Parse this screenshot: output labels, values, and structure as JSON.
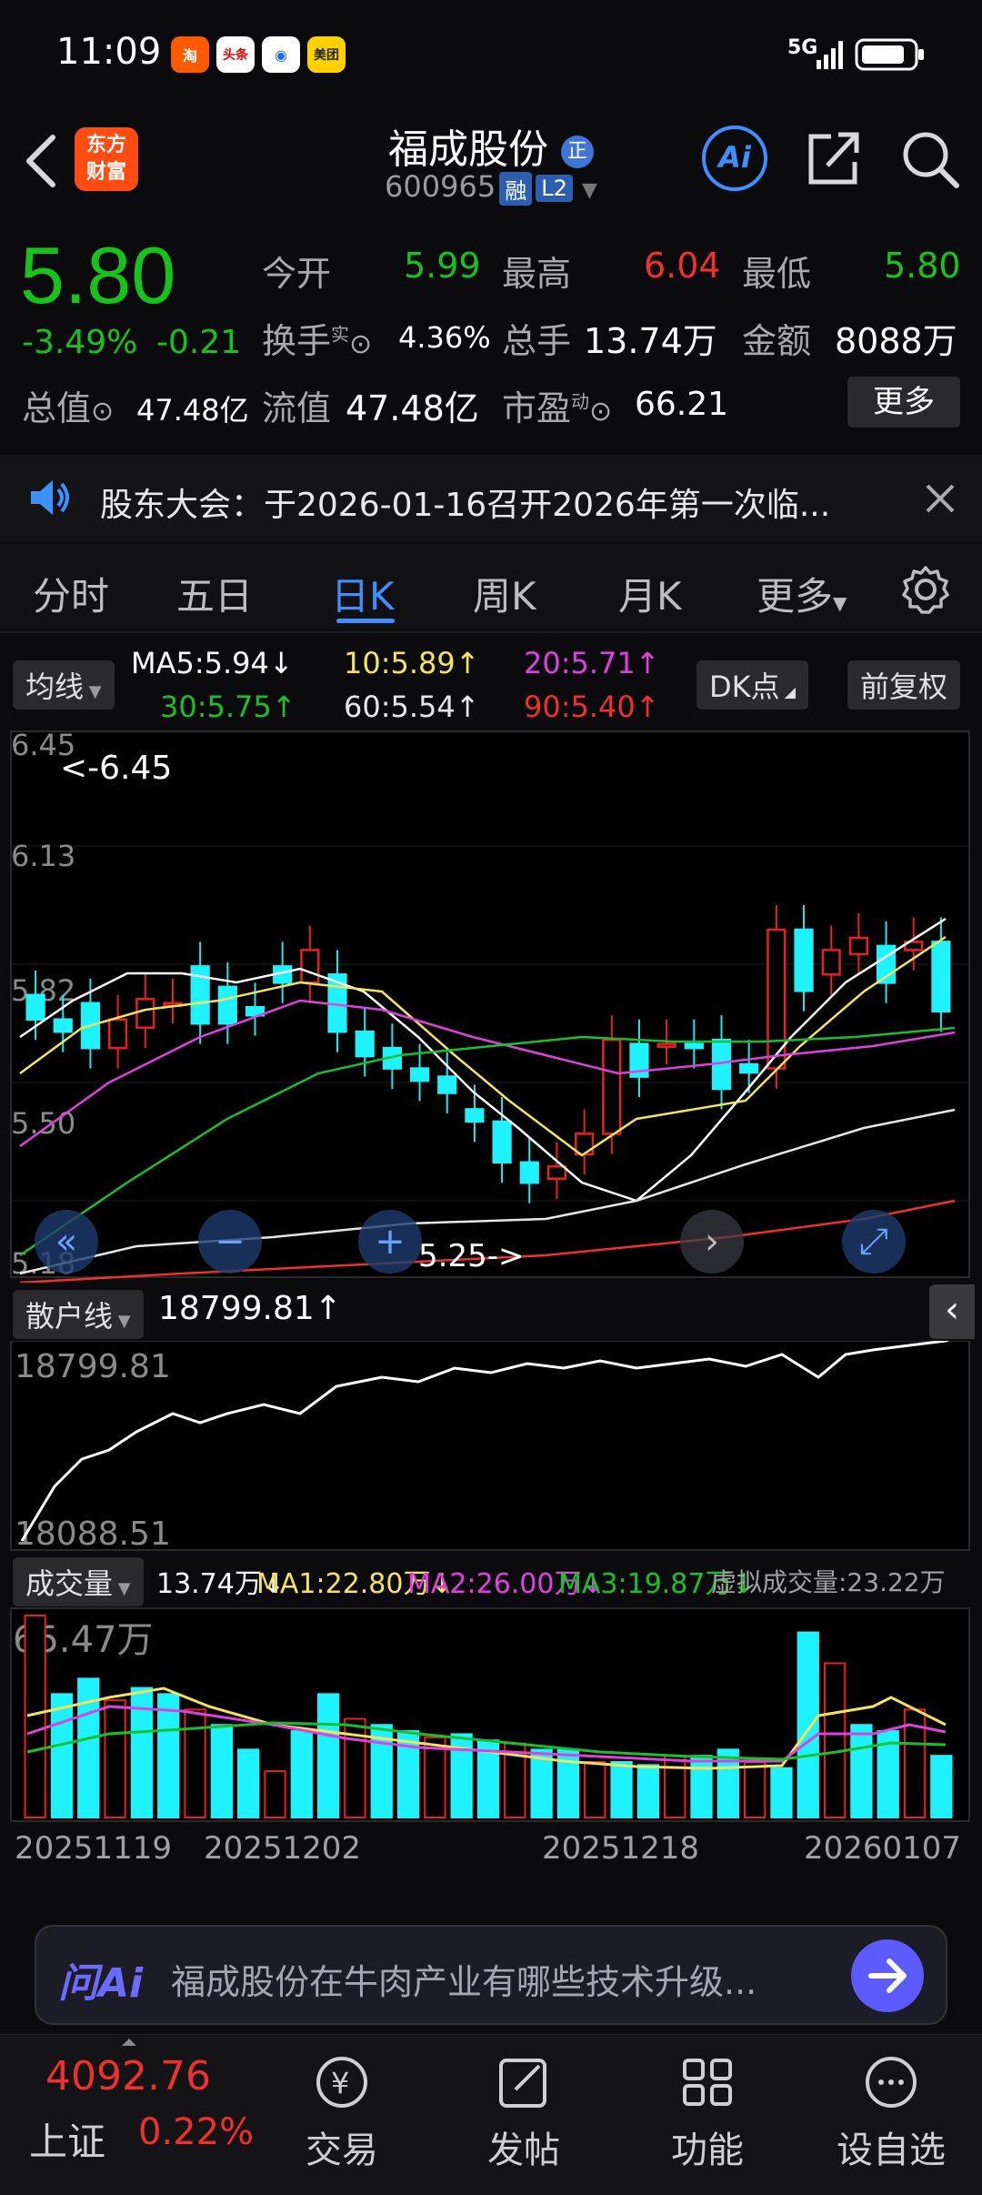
{
  "status_bar": {
    "time": "11:09",
    "apps": [
      "淘",
      "头条",
      "◉",
      "美团"
    ],
    "network": "5G"
  },
  "header": {
    "back_icon": "chevron-left-icon",
    "logo_line1": "东方",
    "logo_line2": "财富",
    "stock_name": "福成股份",
    "badge": "正",
    "code": "600965",
    "tag_margin": "融",
    "tag_level": "L2",
    "ai_label": "Ai"
  },
  "quote": {
    "price": "5.80",
    "change_pct": "-3.49%",
    "change_amt": "-0.21",
    "open_label": "今开",
    "open": "5.99",
    "high_label": "最高",
    "high": "6.04",
    "low_label": "最低",
    "low": "5.80",
    "turnover_label": "换手",
    "turnover_sup": "实",
    "turnover": "4.36%",
    "volume_label": "总手",
    "volume": "13.74万",
    "amount_label": "金额",
    "amount": "8088万",
    "mktcap_label": "总值",
    "mktcap": "47.48亿",
    "float_label": "流值",
    "float": "47.48亿",
    "pe_label": "市盈",
    "pe_sup": "动",
    "pe": "66.21",
    "more": "更多"
  },
  "notice": {
    "text": "股东大会：于2026-01-16召开2026年第一次临..."
  },
  "tabs": [
    "分时",
    "五日",
    "日K",
    "周K",
    "月K",
    "更多"
  ],
  "ma": {
    "label": "均线",
    "ma5": "MA5:5.94↓",
    "ma10": "10:5.89↑",
    "ma20": "20:5.71↑",
    "ma30": "30:5.75↑",
    "ma60": "60:5.54↑",
    "ma90": "90:5.40↑",
    "dk": "DK点",
    "adjust": "前复权"
  },
  "kchart": {
    "y_labels": [
      "6.45",
      "6.13",
      "5.82",
      "5.50",
      "5.18"
    ],
    "high_mark": "<-6.45",
    "low_mark": "5.25->"
  },
  "indicator": {
    "label": "散户线",
    "value": "18799.81↑",
    "top": "18799.81",
    "bottom": "18088.51"
  },
  "volume": {
    "label": "成交量",
    "vol": "13.74万↓",
    "ma1": "MA1:22.80万↓",
    "ma2": "MA2:26.00万↓",
    "ma3": "MA3:19.87万↓",
    "virtual": "虚拟成交量:23.22万",
    "top": "65.47万"
  },
  "dates": [
    "20251119",
    "20251202",
    "20251218",
    "20260107"
  ],
  "ai_bar": {
    "label": "问Ai",
    "text": "福成股份在牛肉产业有哪些技术升级..."
  },
  "nav": {
    "index_value": "4092.76",
    "index_name": "上证",
    "index_pct": "0.22%",
    "items": [
      "交易",
      "发帖",
      "功能",
      "设自选"
    ]
  },
  "chart_data": {
    "type": "candlestick",
    "y_range": [
      5.18,
      6.45
    ],
    "candles": [
      {
        "o": 5.84,
        "c": 5.78
      },
      {
        "o": 5.78,
        "c": 5.75
      },
      {
        "o": 5.82,
        "c": 5.71
      },
      {
        "o": 5.71,
        "c": 5.78
      },
      {
        "o": 5.76,
        "c": 5.83
      },
      {
        "o": 5.82,
        "c": 5.82
      },
      {
        "o": 5.91,
        "c": 5.77
      },
      {
        "o": 5.86,
        "c": 5.77
      },
      {
        "o": 5.81,
        "c": 5.79
      },
      {
        "o": 5.91,
        "c": 5.87
      },
      {
        "o": 5.87,
        "c": 5.95
      },
      {
        "o": 5.89,
        "c": 5.75
      },
      {
        "o": 5.75,
        "c": 5.69
      },
      {
        "o": 5.71,
        "c": 5.66
      },
      {
        "o": 5.66,
        "c": 5.63
      },
      {
        "o": 5.64,
        "c": 5.6
      },
      {
        "o": 5.56,
        "c": 5.53
      },
      {
        "o": 5.53,
        "c": 5.43
      },
      {
        "o": 5.43,
        "c": 5.38
      },
      {
        "o": 5.39,
        "c": 5.42
      },
      {
        "o": 5.45,
        "c": 5.5
      },
      {
        "o": 5.5,
        "c": 5.73
      },
      {
        "o": 5.72,
        "c": 5.64
      },
      {
        "o": 5.72,
        "c": 5.72
      },
      {
        "o": 5.72,
        "c": 5.71
      },
      {
        "o": 5.73,
        "c": 5.61
      },
      {
        "o": 5.67,
        "c": 5.65
      },
      {
        "o": 5.66,
        "c": 6.0
      },
      {
        "o": 6.0,
        "c": 5.85
      },
      {
        "o": 5.89,
        "c": 5.95
      },
      {
        "o": 5.94,
        "c": 5.98
      },
      {
        "o": 5.96,
        "c": 5.87
      },
      {
        "o": 5.95,
        "c": 5.97
      },
      {
        "o": 5.97,
        "c": 5.8
      }
    ],
    "volumes": [
      65.47,
      40,
      45,
      38,
      42,
      40,
      35,
      30,
      22,
      15,
      28,
      40,
      32,
      30,
      28,
      26,
      27,
      25,
      24,
      22,
      22,
      18,
      18,
      17,
      20,
      20,
      22,
      18,
      16,
      60,
      50,
      30,
      28,
      35,
      20
    ]
  }
}
